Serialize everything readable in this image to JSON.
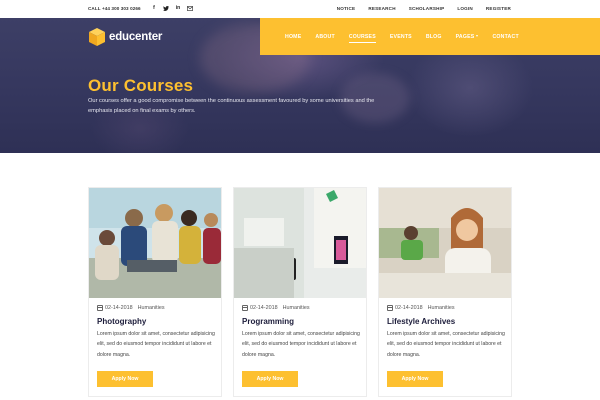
{
  "topbar": {
    "phone": "CALL +44 300 303 0266",
    "socials": [
      "facebook-icon",
      "twitter-icon",
      "linkedin-icon",
      "mail-icon"
    ],
    "links": [
      "NOTICE",
      "RESEARCH",
      "SCHOLARSHIP",
      "LOGIN",
      "REGISTER"
    ]
  },
  "brand": {
    "logo_text_a": "edu",
    "logo_text_b": "center",
    "accent": "#fdc030"
  },
  "nav": {
    "items": [
      "HOME",
      "ABOUT",
      "COURSES",
      "EVENTS",
      "BLOG",
      "PAGES",
      "CONTACT"
    ],
    "active": "COURSES"
  },
  "hero": {
    "title": "Our Courses",
    "description": "Our courses offer a good compromise between the continuous assessment favoured by some universities and the emphasis placed on final exams by others."
  },
  "courses": [
    {
      "date": "02-14-2018",
      "category": "Humanities",
      "title": "Photography",
      "text": "Lorem ipsum dolor sit amet, consectetur adipisicing elit, sed do eiusmod tempor incididunt ut labore et dolore magna.",
      "button": "Apply Now"
    },
    {
      "date": "02-14-2018",
      "category": "Humanities",
      "title": "Programming",
      "text": "Lorem ipsum dolor sit amet, consectetur adipisicing elit, sed do eiusmod tempor incididunt ut labore et dolore magna.",
      "button": "Apply Now"
    },
    {
      "date": "02-14-2018",
      "category": "Humanities",
      "title": "Lifestyle Archives",
      "text": "Lorem ipsum dolor sit amet, consectetur adipisicing elit, sed do eiusmod tempor incididunt ut labore et dolore magna.",
      "button": "Apply Now"
    }
  ]
}
